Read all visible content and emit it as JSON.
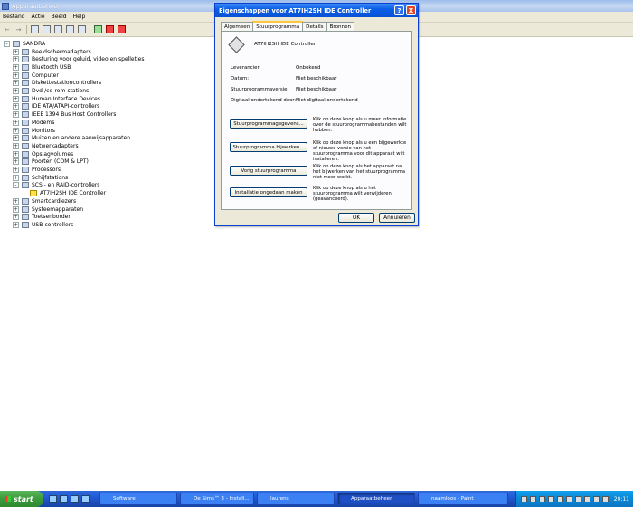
{
  "window": {
    "title": "Apparaatbeheer"
  },
  "menu": [
    "Bestand",
    "Actie",
    "Beeld",
    "Help"
  ],
  "tree": {
    "root": "SANDRA",
    "items": [
      "Beeldschermadapters",
      "Besturing voor geluid, video en spelletjes",
      "Bluetooth USB",
      "Computer",
      "Diskettestationcontrollers",
      "Dvd-/cd-rom-stations",
      "Human Interface Devices",
      "IDE ATA/ATAPI-controllers",
      "IEEE 1394 Bus Host Controllers",
      "Modems",
      "Monitors",
      "Muizen en andere aanwijsapparaten",
      "Netwerkadapters",
      "Opslagvolumes",
      "Poorten (COM & LPT)",
      "Processors",
      "Schijfstations",
      "SCSI- en RAID-controllers",
      "AT7IH2SH IDE Controller",
      "Smartcardlezers",
      "Systeemapparaten",
      "Toetsenborden",
      "USB-controllers"
    ]
  },
  "dialog": {
    "title": "Eigenschappen voor AT7IH2SH IDE Controller",
    "help": "?",
    "close": "X",
    "tabs": [
      "Algemeen",
      "Stuurprogramma",
      "Details",
      "Bronnen"
    ],
    "device_name": "AT7IH2SH IDE Controller",
    "info": [
      {
        "label": "Leverancier:",
        "value": "Onbekend"
      },
      {
        "label": "Datum:",
        "value": "Niet beschikbaar"
      },
      {
        "label": "Stuurprogrammaversie:",
        "value": "Niet beschikbaar"
      },
      {
        "label": "Digitaal ondertekend door:",
        "value": "Niet digitaal ondertekend"
      }
    ],
    "actions": [
      {
        "button": "Stuurprogrammagegevens...",
        "desc": "Klik op deze knop als u meer informatie over de stuurprogrammabestanden wilt hebben."
      },
      {
        "button": "Stuurprogramma bijwerken...",
        "desc": "Klik op deze knop als u een bijgewerkte of nieuwe versie van het stuurprogramma voor dit apparaat wilt installeren."
      },
      {
        "button": "Vorig stuurprogramma",
        "desc": "Klik op deze knop als het apparaat na het bijwerken van het stuurprogramma niet meer werkt."
      },
      {
        "button": "Installatie ongedaan maken",
        "desc": "Klik op deze knop als u het stuurprogramma wilt verwijderen (geavanceerd)."
      }
    ],
    "ok": "OK",
    "cancel": "Annuleren"
  },
  "taskbar": {
    "start": "start",
    "tasks": [
      "Software",
      "De Sims™ 3 - Install...",
      "laurens",
      "Apparaatbeheer",
      "naamloos - Paint"
    ],
    "clock": "20:11"
  }
}
